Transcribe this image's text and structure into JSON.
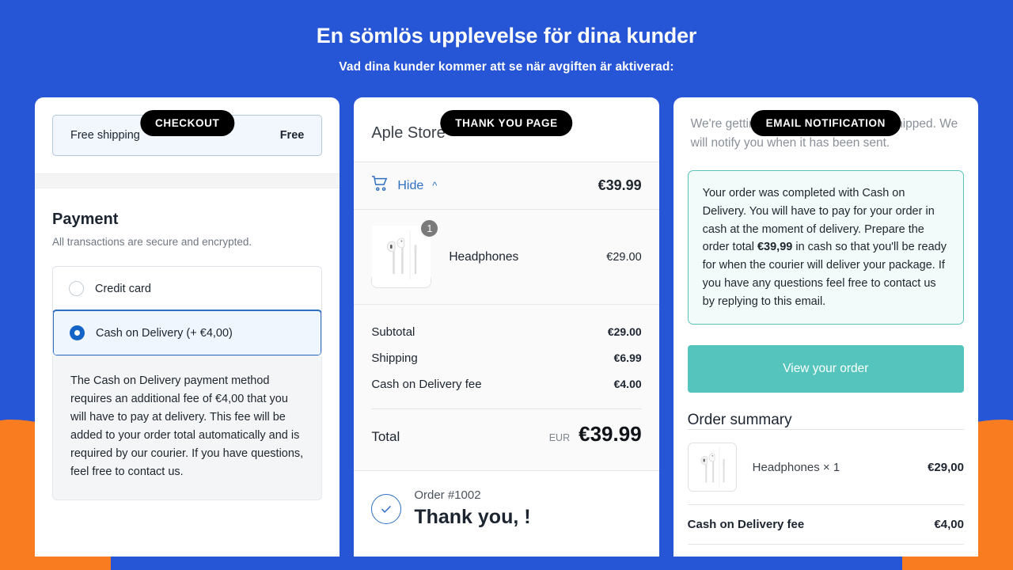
{
  "theme": {
    "background": "#2655d6",
    "accent_orange": "#f97d20",
    "accent_teal": "#54c4bc",
    "link_blue": "#2e6fc4"
  },
  "header": {
    "title": "En sömlös upplevelse för dina kunder",
    "subtitle": "Vad dina kunder kommer att se när avgiften är aktiverad:"
  },
  "checkout": {
    "badge": "CHECKOUT",
    "shipping_label": "Free shipping",
    "shipping_value": "Free",
    "payment_title": "Payment",
    "payment_subtitle": "All transactions are secure and encrypted.",
    "methods": [
      {
        "label": "Credit card",
        "selected": false
      },
      {
        "label": "Cash on Delivery (+ €4,00)",
        "selected": true
      }
    ],
    "cod_description": "The Cash on Delivery payment method requires an additional fee of €4,00 that you will have to pay at delivery. This fee will be added to your order total automatically and is required by our courier. If you have questions, feel free to contact us."
  },
  "thankyou": {
    "badge": "THANK YOU PAGE",
    "store_name": "Aple Store",
    "hide_label": "Hide",
    "cart_total": "€39.99",
    "items": [
      {
        "name": "Headphones",
        "qty": "1",
        "price": "€29.00"
      }
    ],
    "totals": [
      {
        "label": "Subtotal",
        "value": "€29.00"
      },
      {
        "label": "Shipping",
        "value": "€6.99"
      },
      {
        "label": "Cash on Delivery fee",
        "value": "€4.00"
      }
    ],
    "grand_label": "Total",
    "currency": "EUR",
    "grand_value": "€39.99",
    "order_number": "Order #1002",
    "thanks_text": "Thank you, !"
  },
  "email": {
    "badge": "EMAIL NOTIFICATION",
    "intro": "We're getting your order ready to be shipped. We will notify you when it has been sent.",
    "note_before": "Your order was completed with Cash on Delivery. You will have to pay for your order in cash at the moment of delivery. Prepare the order total ",
    "note_amount": "€39,99",
    "note_after": " in cash so that you'll be ready for when the courier will deliver your package. If you have any questions feel free to contact us by replying to this email.",
    "view_order_button": "View your order",
    "summary_title": "Order summary",
    "summary_rows": [
      {
        "name": "Headphones × 1",
        "value": "€29,00",
        "has_thumb": true
      },
      {
        "name": "Cash on Delivery fee",
        "value": "€4,00",
        "has_thumb": false
      }
    ]
  }
}
